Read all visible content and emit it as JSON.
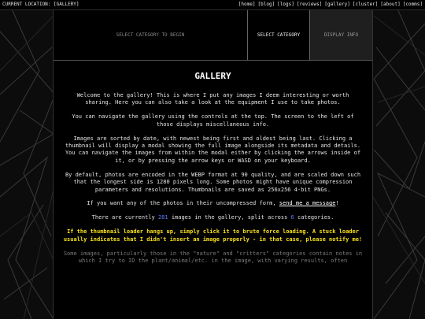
{
  "topbar": {
    "location": "CURRENT LOCATION: [GALLERY]",
    "nav": [
      "[home]",
      "[blog]",
      "[logs]",
      "[reviews]",
      "[gallery]",
      "[cluster]",
      "[about]",
      "[comms]"
    ]
  },
  "controls": {
    "select_prompt": "SELECT CATEGORY TO BEGIN",
    "select_category": "SELECT CATEGORY",
    "display_info": "DISPLAY INFO"
  },
  "main": {
    "title": "GALLERY",
    "p1": "Welcome to the gallery! This is where I put any images I deem interesting or worth sharing. Here you can also take a look at the equipment I use to take photos.",
    "p2": "You can navigate the gallery using the controls at the top. The screen to the left of those displays miscellaneous info.",
    "p3": "Images are sorted by date, with newest being first and oldest being last. Clicking a thumbnail will display a modal showing the full image alongside its metadata and details. You can navigate the images from within the modal either by clicking the arrows inside of it, or by pressing the arrow keys or WASD on your keyboard.",
    "p4": "By default, photos are encoded in the WEBP format at 90 quality, and are scaled down such that the longest side is 1280 pixels long. Some photos might have unique compression parameters and resolutions. Thumbnails are saved as 256x256 4-bit PNGs.",
    "p5_pre": "If you want any of the photos in their uncompressed form, ",
    "p5_link": "send me a message",
    "p5_post": "!",
    "p6_pre": "There are currently ",
    "image_count": "281",
    "p6_mid": " images in the gallery, split across ",
    "category_count": "6",
    "p6_post": " categories.",
    "warning": "If the thumbnail loader hangs up, simply click it to brute force loading. A stuck loader usually indicates that I didn't insert an image properly - in that case, please notify me!",
    "p7": "Some images, particularly those in the \"nature\" and \"critters\" categories contain notes in which I try to ID the plant/animal/etc. in the image, with varying results, often"
  },
  "colors": {
    "accent_number": "#5f7dff",
    "warning": "#f7e01c",
    "background": "#0c0c0c"
  }
}
